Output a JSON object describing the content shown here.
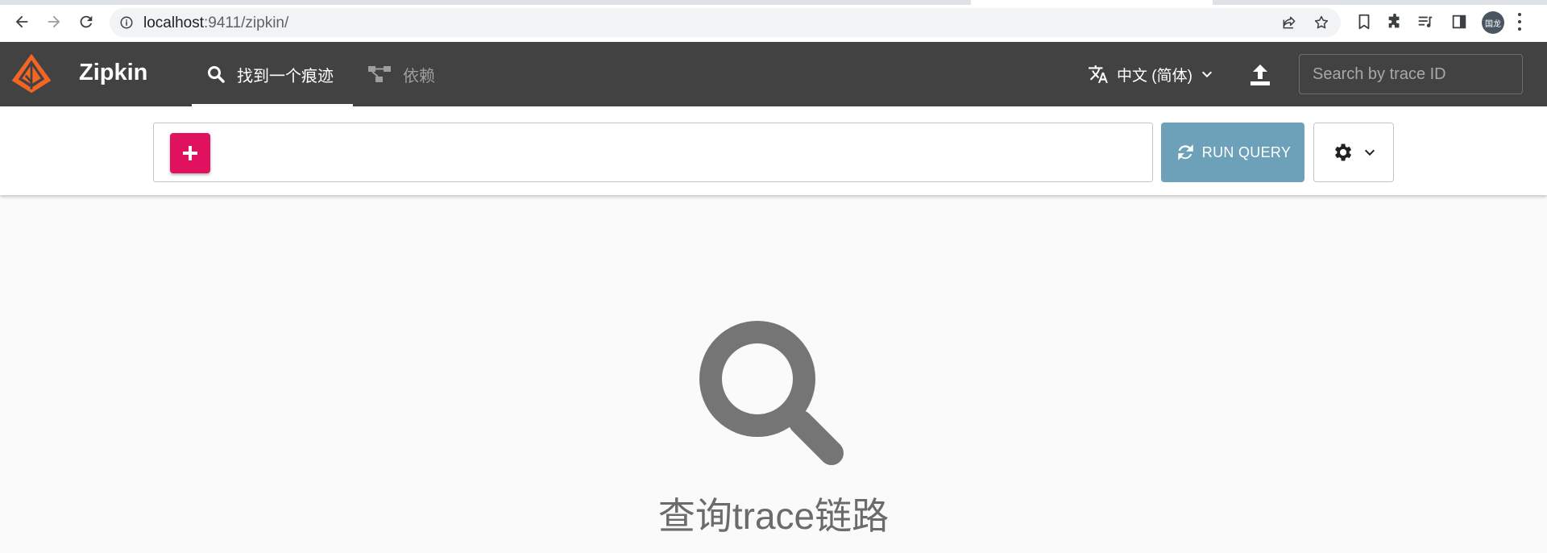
{
  "browser": {
    "url_host": "localhost",
    "url_path": ":9411/zipkin/",
    "profile_label": "国龙",
    "colors": {
      "toolbar": "#ffffff",
      "omnibox": "#f1f3f4"
    }
  },
  "header": {
    "brand": "Zipkin",
    "tabs": [
      {
        "label": "找到一个痕迹",
        "icon": "search-icon",
        "active": true
      },
      {
        "label": "依赖",
        "icon": "dependency-graph-icon",
        "active": false
      }
    ],
    "language": "中文 (简体)",
    "trace_search_placeholder": "Search by trace ID",
    "colors": {
      "background": "#424242",
      "logo": "#f26522"
    }
  },
  "query": {
    "run_label": "RUN QUERY",
    "colors": {
      "add_button": "#e0115f",
      "run_button": "#6ca1b9"
    }
  },
  "empty_state": {
    "message": "查询trace链路",
    "icon": "magnifier-icon"
  }
}
